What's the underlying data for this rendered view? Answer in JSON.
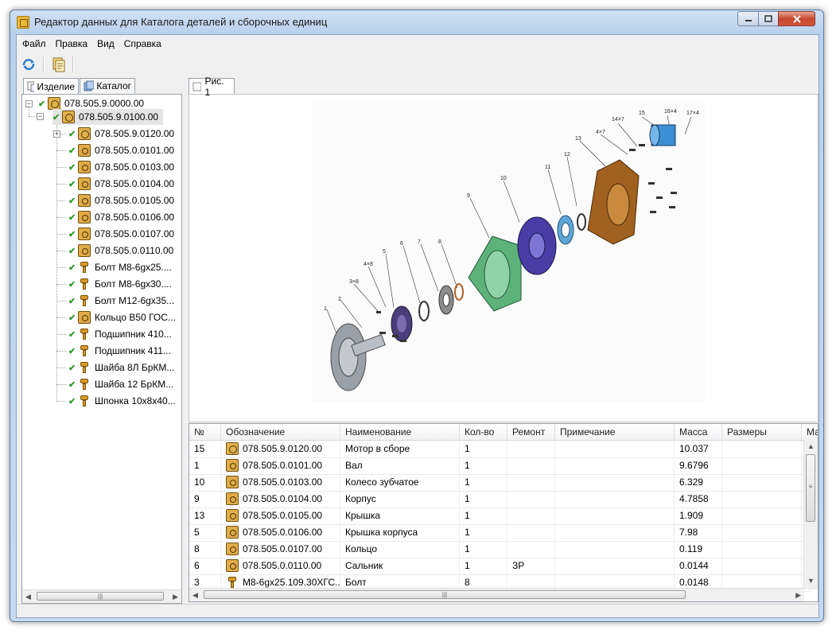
{
  "window": {
    "title": "Редактор данных для Каталога деталей и сборочных единиц"
  },
  "menu": [
    "Файл",
    "Правка",
    "Вид",
    "Справка"
  ],
  "left_tabs": [
    {
      "label": "Изделие",
      "active": true
    },
    {
      "label": "Каталог",
      "active": false
    }
  ],
  "right_tabs": [
    {
      "label": "Рис. 1"
    }
  ],
  "tree": {
    "root": "078.505.9.0000.00",
    "child": "078.505.9.0100.00",
    "items": [
      {
        "label": "078.505.9.0120.00",
        "icon": "assembly-icon",
        "expandable": true
      },
      {
        "label": "078.505.0.0101.00",
        "icon": "part-icon"
      },
      {
        "label": "078.505.0.0103.00",
        "icon": "part-icon"
      },
      {
        "label": "078.505.0.0104.00",
        "icon": "part-icon"
      },
      {
        "label": "078.505.0.0105.00",
        "icon": "part-icon"
      },
      {
        "label": "078.505.0.0106.00",
        "icon": "part-icon"
      },
      {
        "label": "078.505.0.0107.00",
        "icon": "part-icon"
      },
      {
        "label": "078.505.0.0110.00",
        "icon": "part-icon"
      },
      {
        "label": "Болт М8-6gx25....",
        "icon": "bolt-icon"
      },
      {
        "label": "Болт М8-6gx30....",
        "icon": "bolt-icon"
      },
      {
        "label": "Болт М12-6gx35...",
        "icon": "bolt-icon"
      },
      {
        "label": "Кольцо В50 ГОС...",
        "icon": "part-icon"
      },
      {
        "label": "Подшипник 410...",
        "icon": "bolt-icon"
      },
      {
        "label": "Подшипник 411...",
        "icon": "bolt-icon"
      },
      {
        "label": "Шайба 8Л БрКМ...",
        "icon": "bolt-icon"
      },
      {
        "label": "Шайба 12 БрКМ...",
        "icon": "bolt-icon"
      },
      {
        "label": "Шпонка 10х8х40...",
        "icon": "bolt-icon"
      }
    ]
  },
  "drawing_labels": [
    "1",
    "2",
    "3×8",
    "4×8",
    "5",
    "6",
    "7",
    "8",
    "9",
    "10",
    "11",
    "12",
    "13",
    "4×7",
    "14×7",
    "15",
    "16×4",
    "17×4"
  ],
  "grid": {
    "columns": [
      "№",
      "Обозначение",
      "Наименование",
      "Кол-во",
      "Ремонт",
      "Примечание",
      "Масса",
      "Размеры",
      "Мате"
    ],
    "rows": [
      {
        "num": "15",
        "icon": "assembly-icon",
        "code": "078.505.9.0120.00",
        "name": "Мотор в сборе",
        "qty": "1",
        "repair": "",
        "note": "",
        "mass": "10.037"
      },
      {
        "num": "1",
        "icon": "part-icon",
        "code": "078.505.0.0101.00",
        "name": "Вал",
        "qty": "1",
        "repair": "",
        "note": "",
        "mass": "9.6796"
      },
      {
        "num": "10",
        "icon": "part-icon",
        "code": "078.505.0.0103.00",
        "name": "Колесо зубчатое",
        "qty": "1",
        "repair": "",
        "note": "",
        "mass": "6.329"
      },
      {
        "num": "9",
        "icon": "part-icon",
        "code": "078.505.0.0104.00",
        "name": "Корпус",
        "qty": "1",
        "repair": "",
        "note": "",
        "mass": "4.7858"
      },
      {
        "num": "13",
        "icon": "part-icon",
        "code": "078.505.0.0105.00",
        "name": "Крышка",
        "qty": "1",
        "repair": "",
        "note": "",
        "mass": "1.909"
      },
      {
        "num": "5",
        "icon": "part-icon",
        "code": "078.505.0.0106.00",
        "name": "Крышка корпуса",
        "qty": "1",
        "repair": "",
        "note": "",
        "mass": "7.98"
      },
      {
        "num": "8",
        "icon": "part-icon",
        "code": "078.505.0.0107.00",
        "name": "Кольцо",
        "qty": "1",
        "repair": "",
        "note": "",
        "mass": "0.119"
      },
      {
        "num": "6",
        "icon": "part-icon",
        "code": "078.505.0.0110.00",
        "name": "Сальник",
        "qty": "1",
        "repair": "ЗР",
        "note": "",
        "mass": "0.0144"
      },
      {
        "num": "3",
        "icon": "bolt-icon",
        "code": "М8-6gx25.109.30ХГС...",
        "name": "Болт",
        "qty": "8",
        "repair": "",
        "note": "",
        "mass": "0.0148"
      }
    ]
  }
}
